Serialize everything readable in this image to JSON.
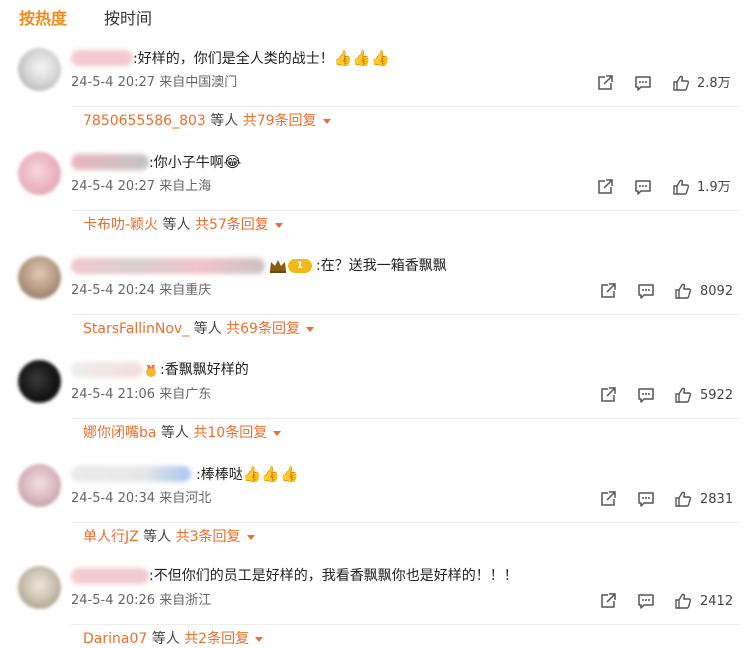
{
  "tabs": [
    {
      "label": "按热度",
      "active": true
    },
    {
      "label": "按时间",
      "active": false
    }
  ],
  "colors": {
    "accent": "#f08b1f",
    "reply_link": "#ea6f2c",
    "meta_text": "#666666"
  },
  "icons": {
    "forward": "share-out-icon",
    "comment": "comment-bubble-icon",
    "like": "thumbs-up-icon",
    "expand": "caret-down-icon"
  },
  "comments": [
    {
      "text": ":好样的，你们是全人类的战士！",
      "emoji": "👍👍👍",
      "date": "24-5-4 20:27",
      "source": "来自中国澳门",
      "likes": "2.8万",
      "reply_user": "7850655586_803",
      "reply_mid": " 等人 ",
      "reply_count": "共79条回复"
    },
    {
      "text": ":你小子牛啊",
      "emoji": "😂",
      "date": "24-5-4 20:27",
      "source": "来自上海",
      "likes": "1.9万",
      "reply_user": "卡布叻-颖火",
      "reply_mid": " 等人 ",
      "reply_count": "共57条回复"
    },
    {
      "badge": "1",
      "text": ":在？送我一箱香飘飘",
      "date": "24-5-4 20:24",
      "source": "来自重庆",
      "likes": "8092",
      "reply_user": "StarsFallinNov_",
      "reply_mid": " 等人 ",
      "reply_count": "共69条回复"
    },
    {
      "text": ":香飘飘好样的",
      "date": "24-5-4 21:06",
      "source": "来自广东",
      "likes": "5922",
      "reply_user": "娜你闭嘴ba",
      "reply_mid": " 等人 ",
      "reply_count": "共10条回复"
    },
    {
      "text": ":棒棒哒",
      "emoji": "👍👍👍",
      "date": "24-5-4 20:34",
      "source": "来自河北",
      "likes": "2831",
      "reply_user": "单人行JZ",
      "reply_mid": " 等人 ",
      "reply_count": "共3条回复"
    },
    {
      "text": ":不但你们的员工是好样的，我看香飘飘你也是好样的！！！",
      "date": "24-5-4 20:26",
      "source": "来自浙江",
      "likes": "2412",
      "reply_user": "Darina07",
      "reply_mid": " 等人 ",
      "reply_count": "共2条回复"
    }
  ]
}
